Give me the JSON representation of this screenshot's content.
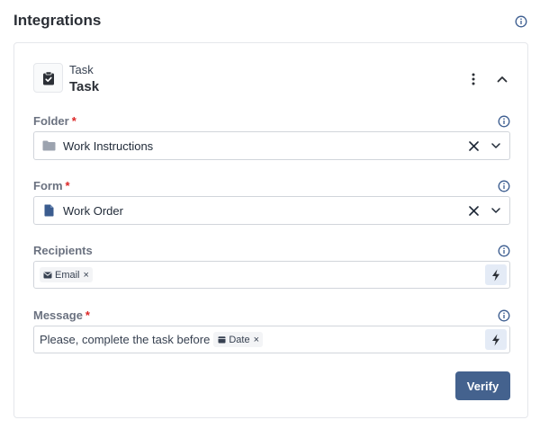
{
  "section": {
    "title": "Integrations"
  },
  "task": {
    "subtitle": "Task",
    "name": "Task"
  },
  "fields": {
    "folder": {
      "label": "Folder",
      "required": "*",
      "value": "Work Instructions",
      "icon": "folder-icon"
    },
    "form": {
      "label": "Form",
      "required": "*",
      "value": "Work Order",
      "icon": "document-icon"
    },
    "recipients": {
      "label": "Recipients",
      "chip": "Email",
      "chip_icon": "envelope-icon",
      "chip_remove": "×"
    },
    "message": {
      "label": "Message",
      "required": "*",
      "text": "Please, complete the task before",
      "chip": "Date",
      "chip_icon": "calendar-icon",
      "chip_remove": "×"
    }
  },
  "actions": {
    "verify_label": "Verify"
  },
  "colors": {
    "accent": "#44628e",
    "info": "#3b5c8f",
    "required": "#dc2626",
    "bolt_bg": "#e4ebf6"
  }
}
